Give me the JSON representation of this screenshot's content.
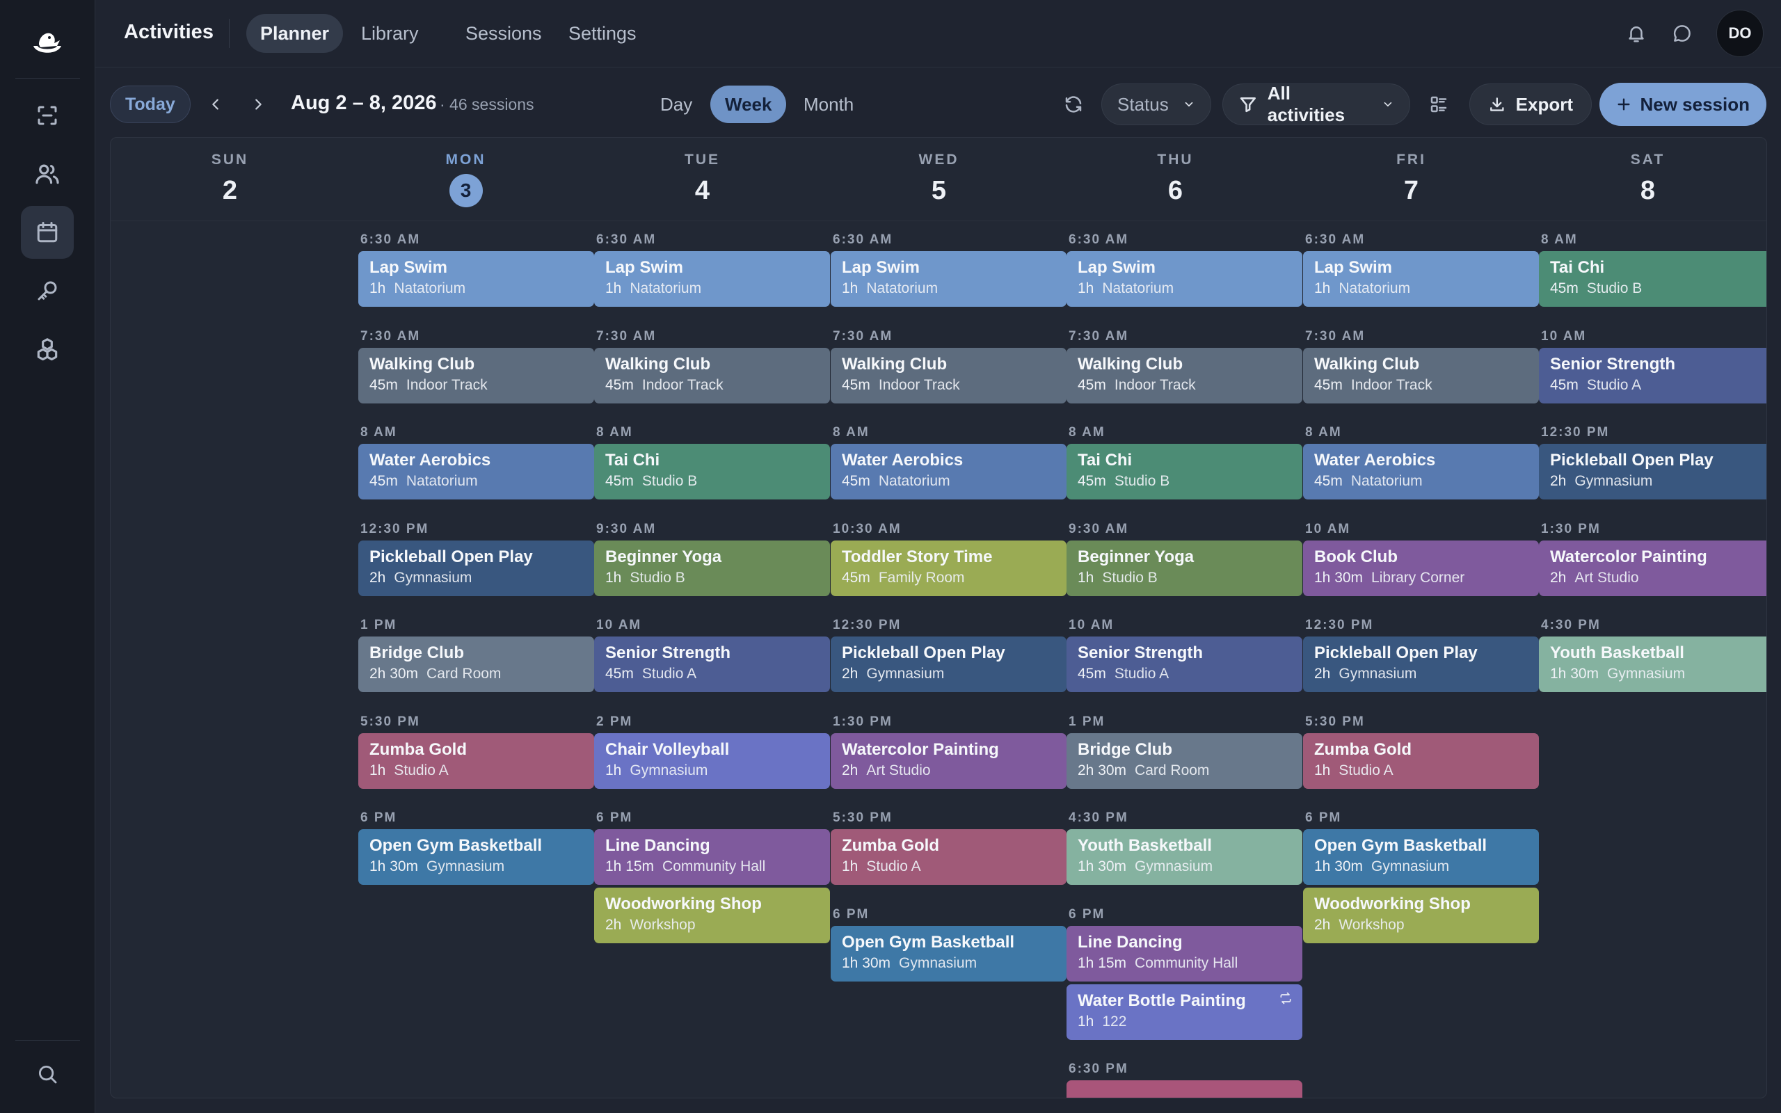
{
  "app": {
    "title": "Activities"
  },
  "nav_tabs": [
    {
      "label": "Planner",
      "active": true
    },
    {
      "label": "Library",
      "active": false
    },
    {
      "label": "Sessions",
      "active": false
    },
    {
      "label": "Settings",
      "active": false
    }
  ],
  "user": {
    "initials": "DO"
  },
  "rail_icons": [
    "logo-icon",
    "scan-icon",
    "users-icon",
    "calendar-icon",
    "key-icon",
    "cubes-icon",
    "search-icon"
  ],
  "toolbar": {
    "today_label": "Today",
    "range": "Aug 2 – 8, 2026",
    "count": "· 46 sessions",
    "views": [
      {
        "label": "Day",
        "active": false
      },
      {
        "label": "Week",
        "active": true
      },
      {
        "label": "Month",
        "active": false
      }
    ],
    "status_label": "Status",
    "filter_label": "All activities",
    "export_label": "Export",
    "new_session_label": "New session"
  },
  "colors": {
    "accent": "#7da2d6",
    "background": "#1f2430",
    "rail": "#171b24"
  },
  "days": [
    {
      "dow": "SUN",
      "num": "2",
      "today": false,
      "slots": []
    },
    {
      "dow": "MON",
      "num": "3",
      "today": true,
      "slots": [
        {
          "time": "6:30 AM",
          "events": [
            {
              "title": "Lap Swim",
              "duration": "1h",
              "location": "Natatorium",
              "color": "blue"
            }
          ]
        },
        {
          "time": "7:30 AM",
          "events": [
            {
              "title": "Walking Club",
              "duration": "45m",
              "location": "Indoor Track",
              "color": "steel"
            }
          ]
        },
        {
          "time": "8 AM",
          "events": [
            {
              "title": "Water Aerobics",
              "duration": "45m",
              "location": "Natatorium",
              "color": "mblue"
            }
          ]
        },
        {
          "time": "12:30 PM",
          "events": [
            {
              "title": "Pickleball Open Play",
              "duration": "2h",
              "location": "Gymnasium",
              "color": "navy"
            }
          ]
        },
        {
          "time": "1 PM",
          "events": [
            {
              "title": "Bridge Club",
              "duration": "2h 30m",
              "location": "Card Room",
              "color": "gray"
            }
          ]
        },
        {
          "time": "5:30 PM",
          "events": [
            {
              "title": "Zumba Gold",
              "duration": "1h",
              "location": "Studio A",
              "color": "rose"
            }
          ]
        },
        {
          "time": "6 PM",
          "events": [
            {
              "title": "Open Gym Basketball",
              "duration": "1h 30m",
              "location": "Gymnasium",
              "color": "cyan"
            }
          ]
        }
      ]
    },
    {
      "dow": "TUE",
      "num": "4",
      "today": false,
      "slots": [
        {
          "time": "6:30 AM",
          "events": [
            {
              "title": "Lap Swim",
              "duration": "1h",
              "location": "Natatorium",
              "color": "blue"
            }
          ]
        },
        {
          "time": "7:30 AM",
          "events": [
            {
              "title": "Walking Club",
              "duration": "45m",
              "location": "Indoor Track",
              "color": "steel"
            }
          ]
        },
        {
          "time": "8 AM",
          "events": [
            {
              "title": "Tai Chi",
              "duration": "45m",
              "location": "Studio B",
              "color": "teal"
            }
          ]
        },
        {
          "time": "9:30 AM",
          "events": [
            {
              "title": "Beginner Yoga",
              "duration": "1h",
              "location": "Studio B",
              "color": "olive"
            }
          ]
        },
        {
          "time": "10 AM",
          "events": [
            {
              "title": "Senior Strength",
              "duration": "45m",
              "location": "Studio A",
              "color": "indigo"
            }
          ]
        },
        {
          "time": "2 PM",
          "events": [
            {
              "title": "Chair Volleyball",
              "duration": "1h",
              "location": "Gymnasium",
              "color": "violet"
            }
          ]
        },
        {
          "time": "6 PM",
          "events": [
            {
              "title": "Line Dancing",
              "duration": "1h 15m",
              "location": "Community Hall",
              "color": "purple"
            },
            {
              "title": "Woodworking Shop",
              "duration": "2h",
              "location": "Workshop",
              "color": "lime"
            }
          ]
        }
      ]
    },
    {
      "dow": "WED",
      "num": "5",
      "today": false,
      "slots": [
        {
          "time": "6:30 AM",
          "events": [
            {
              "title": "Lap Swim",
              "duration": "1h",
              "location": "Natatorium",
              "color": "blue"
            }
          ]
        },
        {
          "time": "7:30 AM",
          "events": [
            {
              "title": "Walking Club",
              "duration": "45m",
              "location": "Indoor Track",
              "color": "steel"
            }
          ]
        },
        {
          "time": "8 AM",
          "events": [
            {
              "title": "Water Aerobics",
              "duration": "45m",
              "location": "Natatorium",
              "color": "mblue"
            }
          ]
        },
        {
          "time": "10:30 AM",
          "events": [
            {
              "title": "Toddler Story Time",
              "duration": "45m",
              "location": "Family Room",
              "color": "lime"
            }
          ]
        },
        {
          "time": "12:30 PM",
          "events": [
            {
              "title": "Pickleball Open Play",
              "duration": "2h",
              "location": "Gymnasium",
              "color": "navy"
            }
          ]
        },
        {
          "time": "1:30 PM",
          "events": [
            {
              "title": "Watercolor Painting",
              "duration": "2h",
              "location": "Art Studio",
              "color": "purple"
            }
          ]
        },
        {
          "time": "5:30 PM",
          "events": [
            {
              "title": "Zumba Gold",
              "duration": "1h",
              "location": "Studio A",
              "color": "rose"
            }
          ]
        },
        {
          "time": "6 PM",
          "events": [
            {
              "title": "Open Gym Basketball",
              "duration": "1h 30m",
              "location": "Gymnasium",
              "color": "cyan"
            }
          ]
        }
      ]
    },
    {
      "dow": "THU",
      "num": "6",
      "today": false,
      "slots": [
        {
          "time": "6:30 AM",
          "events": [
            {
              "title": "Lap Swim",
              "duration": "1h",
              "location": "Natatorium",
              "color": "blue"
            }
          ]
        },
        {
          "time": "7:30 AM",
          "events": [
            {
              "title": "Walking Club",
              "duration": "45m",
              "location": "Indoor Track",
              "color": "steel"
            }
          ]
        },
        {
          "time": "8 AM",
          "events": [
            {
              "title": "Tai Chi",
              "duration": "45m",
              "location": "Studio B",
              "color": "teal"
            }
          ]
        },
        {
          "time": "9:30 AM",
          "events": [
            {
              "title": "Beginner Yoga",
              "duration": "1h",
              "location": "Studio B",
              "color": "olive"
            }
          ]
        },
        {
          "time": "10 AM",
          "events": [
            {
              "title": "Senior Strength",
              "duration": "45m",
              "location": "Studio A",
              "color": "indigo"
            }
          ]
        },
        {
          "time": "1 PM",
          "events": [
            {
              "title": "Bridge Club",
              "duration": "2h 30m",
              "location": "Card Room",
              "color": "gray"
            }
          ]
        },
        {
          "time": "4:30 PM",
          "events": [
            {
              "title": "Youth Basketball",
              "duration": "1h 30m",
              "location": "Gymnasium",
              "color": "sage"
            }
          ]
        },
        {
          "time": "6 PM",
          "events": [
            {
              "title": "Line Dancing",
              "duration": "1h 15m",
              "location": "Community Hall",
              "color": "purple"
            },
            {
              "title": "Water Bottle Painting",
              "duration": "1h",
              "location": "122",
              "color": "violet",
              "repeat": true
            }
          ]
        },
        {
          "time": "6:30 PM",
          "events": [
            {
              "title": "",
              "duration": "",
              "location": "",
              "color": "pink"
            }
          ]
        }
      ]
    },
    {
      "dow": "FRI",
      "num": "7",
      "today": false,
      "slots": [
        {
          "time": "6:30 AM",
          "events": [
            {
              "title": "Lap Swim",
              "duration": "1h",
              "location": "Natatorium",
              "color": "blue"
            }
          ]
        },
        {
          "time": "7:30 AM",
          "events": [
            {
              "title": "Walking Club",
              "duration": "45m",
              "location": "Indoor Track",
              "color": "steel"
            }
          ]
        },
        {
          "time": "8 AM",
          "events": [
            {
              "title": "Water Aerobics",
              "duration": "45m",
              "location": "Natatorium",
              "color": "mblue"
            }
          ]
        },
        {
          "time": "10 AM",
          "events": [
            {
              "title": "Book Club",
              "duration": "1h 30m",
              "location": "Library Corner",
              "color": "purple"
            }
          ]
        },
        {
          "time": "12:30 PM",
          "events": [
            {
              "title": "Pickleball Open Play",
              "duration": "2h",
              "location": "Gymnasium",
              "color": "navy"
            }
          ]
        },
        {
          "time": "5:30 PM",
          "events": [
            {
              "title": "Zumba Gold",
              "duration": "1h",
              "location": "Studio A",
              "color": "rose"
            }
          ]
        },
        {
          "time": "6 PM",
          "events": [
            {
              "title": "Open Gym Basketball",
              "duration": "1h 30m",
              "location": "Gymnasium",
              "color": "cyan"
            },
            {
              "title": "Woodworking Shop",
              "duration": "2h",
              "location": "Workshop",
              "color": "lime"
            }
          ]
        }
      ]
    },
    {
      "dow": "SAT",
      "num": "8",
      "today": false,
      "slots": [
        {
          "time": "8 AM",
          "events": [
            {
              "title": "Tai Chi",
              "duration": "45m",
              "location": "Studio B",
              "color": "teal"
            }
          ]
        },
        {
          "time": "10 AM",
          "events": [
            {
              "title": "Senior Strength",
              "duration": "45m",
              "location": "Studio A",
              "color": "indigo"
            }
          ]
        },
        {
          "time": "12:30 PM",
          "events": [
            {
              "title": "Pickleball Open Play",
              "duration": "2h",
              "location": "Gymnasium",
              "color": "navy"
            }
          ]
        },
        {
          "time": "1:30 PM",
          "events": [
            {
              "title": "Watercolor Painting",
              "duration": "2h",
              "location": "Art Studio",
              "color": "purple"
            }
          ]
        },
        {
          "time": "4:30 PM",
          "events": [
            {
              "title": "Youth Basketball",
              "duration": "1h 30m",
              "location": "Gymnasium",
              "color": "sage"
            }
          ]
        }
      ]
    }
  ]
}
